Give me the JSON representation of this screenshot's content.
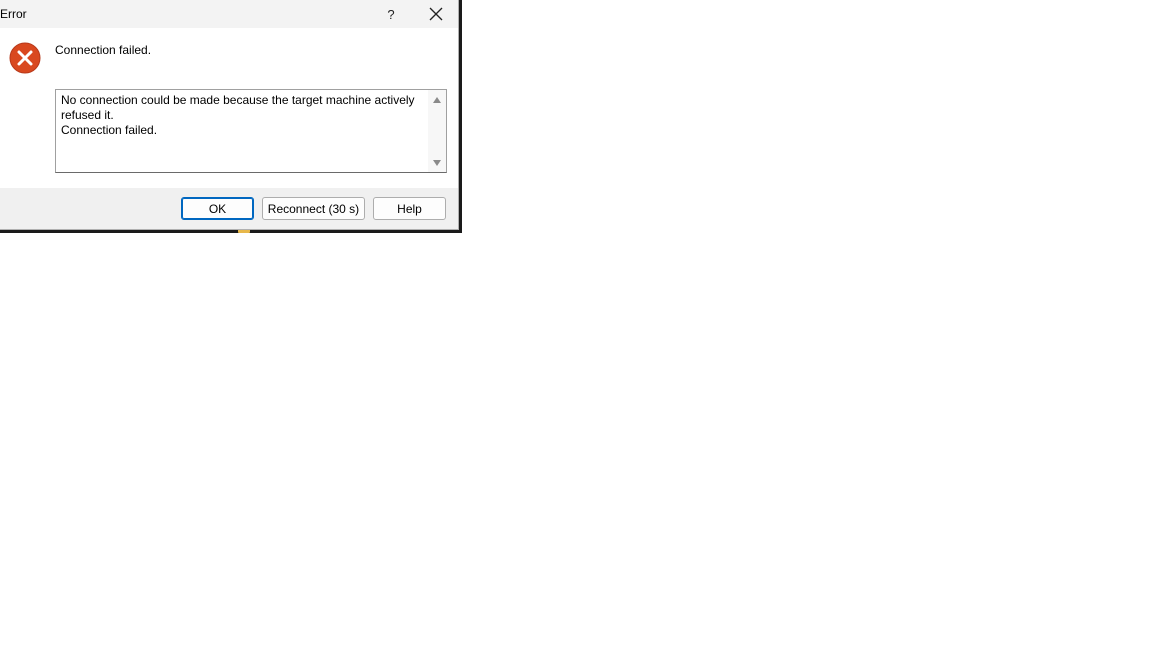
{
  "dialog": {
    "title": "Error",
    "help_label": "?",
    "headline": "Connection failed.",
    "details": "No connection could be made because the target machine actively\nrefused it.\nConnection failed.",
    "buttons": {
      "ok": "OK",
      "reconnect": "Reconnect (30 s)",
      "help": "Help"
    }
  },
  "icons": {
    "error": "error-circle-x-icon",
    "close": "close-icon"
  },
  "colors": {
    "error_icon": "#d9481f",
    "default_button_border": "#0067c0"
  }
}
